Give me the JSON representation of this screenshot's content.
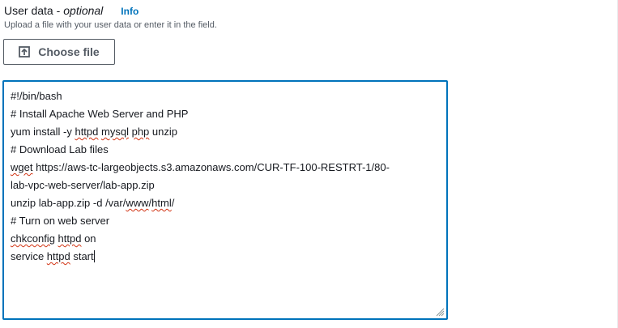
{
  "field": {
    "label": "User data -",
    "label_optional": "optional",
    "info_link": "Info",
    "description": "Upload a file with your user data or enter it in the field."
  },
  "upload": {
    "button_label": "Choose file",
    "icon": "upload-icon"
  },
  "user_data": {
    "lines": [
      [
        "#!/bin/bash"
      ],
      [
        "# Install Apache Web Server and PHP"
      ],
      [
        "yum install -y ",
        {
          "t": "httpd"
        },
        " ",
        {
          "t": "mysql"
        },
        " ",
        {
          "t": "php"
        },
        " unzip"
      ],
      [
        "# Download Lab files"
      ],
      [
        {
          "t": "wget"
        },
        " https://aws-tc-largeobjects.s3.amazonaws.com/CUR-TF-100-RESTRT-1/80-"
      ],
      [
        "lab-vpc-web-server/lab-app.zip"
      ],
      [
        "unzip lab-app.zip -d /var/",
        {
          "t": "www"
        },
        "/",
        {
          "t": "html"
        },
        "/"
      ],
      [
        "# Turn on web server"
      ],
      [
        {
          "t": "chkconfig"
        },
        " ",
        {
          "t": "httpd"
        },
        " on"
      ],
      [
        "service ",
        {
          "t": "httpd"
        },
        " start"
      ]
    ]
  },
  "colors": {
    "focus_border": "#0073bb",
    "link": "#0073bb",
    "spellcheck_underline": "#d13212",
    "button_border": "#545b64"
  }
}
